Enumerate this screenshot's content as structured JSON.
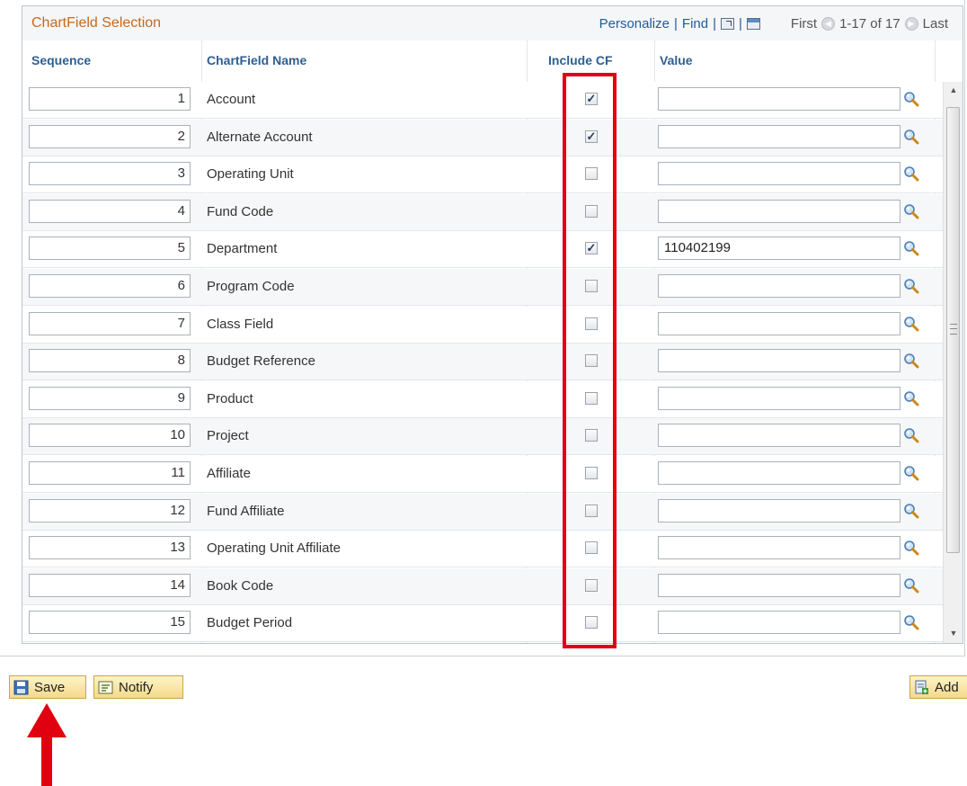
{
  "grid": {
    "title": "ChartField Selection",
    "personalize": "Personalize",
    "find": "Find",
    "first": "First",
    "range": "1-17 of 17",
    "last": "Last"
  },
  "columns": {
    "sequence": "Sequence",
    "chartfield_name": "ChartField Name",
    "include_cf": "Include CF",
    "value": "Value"
  },
  "rows": [
    {
      "seq": "1",
      "name": "Account",
      "include": true,
      "value": ""
    },
    {
      "seq": "2",
      "name": "Alternate Account",
      "include": true,
      "value": ""
    },
    {
      "seq": "3",
      "name": "Operating Unit",
      "include": false,
      "value": ""
    },
    {
      "seq": "4",
      "name": "Fund Code",
      "include": false,
      "value": ""
    },
    {
      "seq": "5",
      "name": "Department",
      "include": true,
      "value": "110402199"
    },
    {
      "seq": "6",
      "name": "Program Code",
      "include": false,
      "value": ""
    },
    {
      "seq": "7",
      "name": "Class Field",
      "include": false,
      "value": ""
    },
    {
      "seq": "8",
      "name": "Budget Reference",
      "include": false,
      "value": ""
    },
    {
      "seq": "9",
      "name": "Product",
      "include": false,
      "value": ""
    },
    {
      "seq": "10",
      "name": "Project",
      "include": false,
      "value": ""
    },
    {
      "seq": "11",
      "name": "Affiliate",
      "include": false,
      "value": ""
    },
    {
      "seq": "12",
      "name": "Fund Affiliate",
      "include": false,
      "value": ""
    },
    {
      "seq": "13",
      "name": "Operating Unit Affiliate",
      "include": false,
      "value": ""
    },
    {
      "seq": "14",
      "name": "Book Code",
      "include": false,
      "value": ""
    },
    {
      "seq": "15",
      "name": "Budget Period",
      "include": false,
      "value": ""
    }
  ],
  "buttons": {
    "save": "Save",
    "notify": "Notify",
    "add": "Add"
  },
  "icons": {
    "lookup": "magnifier-icon",
    "save": "floppy-disk-icon",
    "notify": "notify-icon",
    "add": "add-document-icon"
  },
  "colors": {
    "title": "#c6691c",
    "header_link": "#1d5c99",
    "highlight": "#e1000f"
  }
}
